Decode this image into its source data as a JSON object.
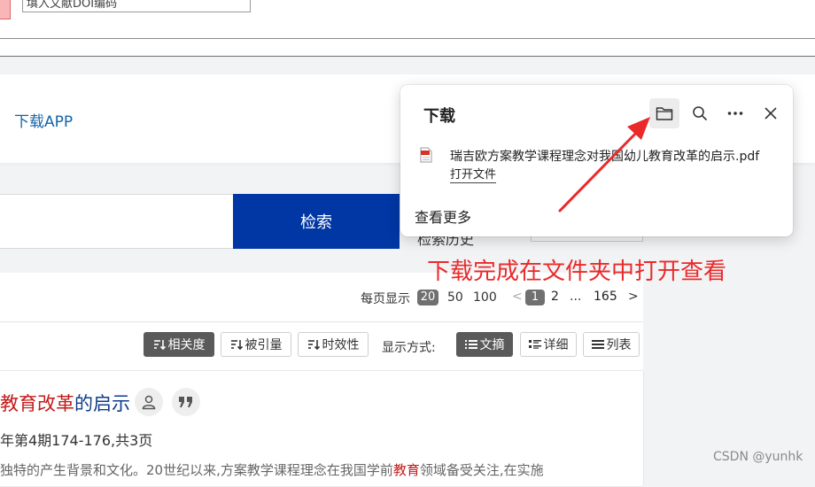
{
  "top": {
    "partial_input_text": "填入文献DOI编码"
  },
  "header": {
    "download_app_link": "下载APP"
  },
  "search": {
    "button_label": "检索",
    "history_label": "检索历史"
  },
  "results": {
    "per_page_label": "每页显示",
    "per_page_options": [
      "20",
      "50",
      "100"
    ],
    "pagination": {
      "prev": "<",
      "current": "1",
      "next_page": "2",
      "ellipsis": "...",
      "last": "165",
      "next": ">"
    },
    "sort_buttons": [
      {
        "label": "相关度",
        "icon": "sort-desc-icon",
        "active": true
      },
      {
        "label": "被引量",
        "icon": "sort-desc-icon",
        "active": false
      },
      {
        "label": "时效性",
        "icon": "sort-desc-icon",
        "active": false
      }
    ],
    "display_mode_label": "显示方式:",
    "view_buttons": [
      {
        "label": "文摘",
        "icon": "list-lines-icon",
        "active": true
      },
      {
        "label": "详细",
        "icon": "list-detail-icon",
        "active": false
      },
      {
        "label": "列表",
        "icon": "list-bars-icon",
        "active": false
      }
    ],
    "item": {
      "title_highlight": "教育改革",
      "title_rest": "的启示",
      "source": "年第4期174-176,共3页",
      "snippet_before": "独特的产生背景和文化。20世纪以来,方案教学课程理念在我国学前",
      "snippet_highlight": "教育",
      "snippet_after": "领域备受关注,在实施"
    }
  },
  "download_flyout": {
    "title": "下载",
    "file_name": "瑞吉欧方案教学课程理念对我国幼儿教育改革的启示.pdf",
    "open_file_label": "打开文件",
    "see_more_label": "查看更多"
  },
  "annotation": {
    "text": "下载完成在文件夹中打开查看",
    "color": "#ea2a2a"
  },
  "watermark": "CSDN @yunhk",
  "colors": {
    "search_button": "#0037a4",
    "link": "#1565a8",
    "title": "#0e3d8a",
    "highlight": "#c41a1a"
  }
}
